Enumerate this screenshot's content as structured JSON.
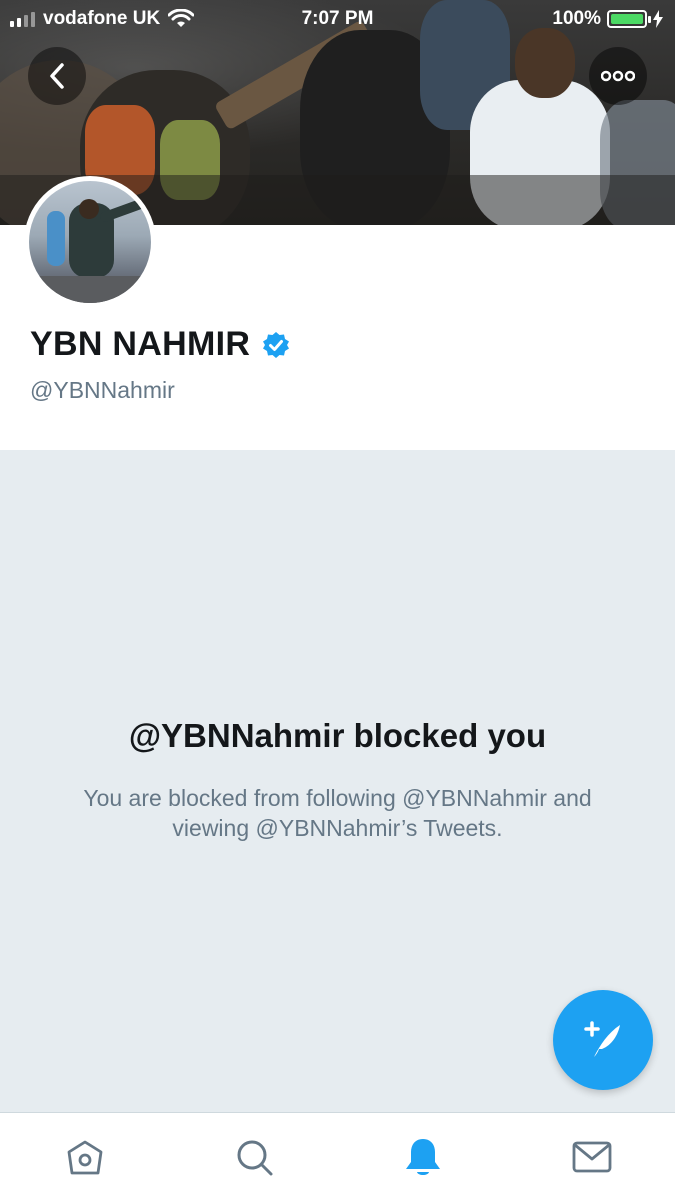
{
  "status_bar": {
    "carrier": "vodafone UK",
    "time": "7:07 PM",
    "battery": "100%"
  },
  "profile": {
    "name": "YBN NAHMIR",
    "handle": "@YBNNahmir",
    "verified": true
  },
  "blocked": {
    "title": "@YBNNahmir blocked you",
    "description": "You are blocked from following @YBNNahmir and viewing @YBNNahmir’s Tweets."
  },
  "icons": {
    "back": "chevron-left-icon",
    "more": "more-icon",
    "compose": "compose-tweet-icon",
    "home": "home-icon",
    "search": "search-icon",
    "notifications": "bell-icon",
    "messages": "mail-icon",
    "verified": "verified-badge-icon"
  },
  "colors": {
    "accent": "#1da1f2",
    "battery": "#4cd964",
    "blocked_bg": "#e6ecf0",
    "text_primary": "#14171a",
    "text_secondary": "#657786",
    "tab_inactive": "#657786"
  },
  "tabs": [
    {
      "name": "home",
      "active": false
    },
    {
      "name": "search",
      "active": false
    },
    {
      "name": "notifications",
      "active": true
    },
    {
      "name": "messages",
      "active": false
    }
  ]
}
